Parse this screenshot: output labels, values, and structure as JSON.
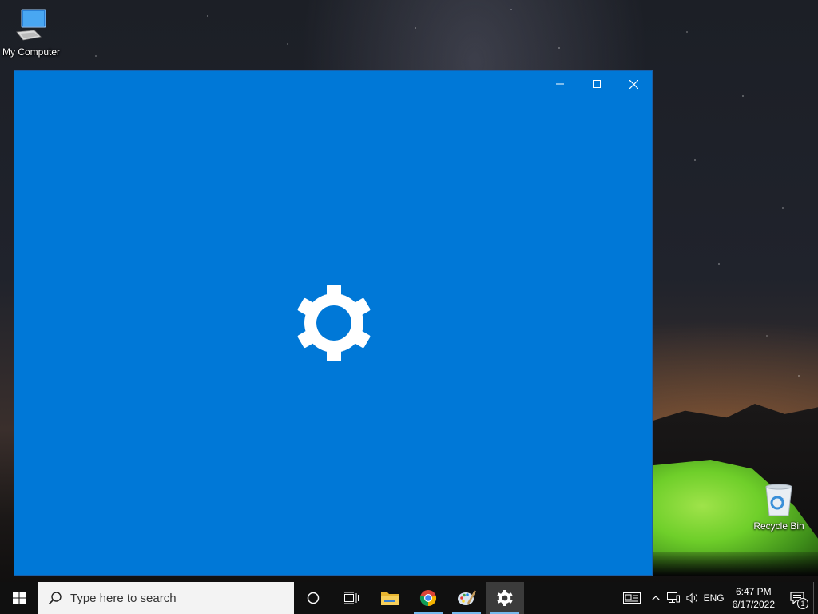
{
  "desktop": {
    "icons": [
      {
        "label": "My Computer",
        "icon": "computer-icon"
      },
      {
        "label": "Recycle Bin",
        "icon": "recycle-bin-icon"
      }
    ]
  },
  "window": {
    "background": "#0078d7",
    "center_icon": "gear-icon",
    "controls": [
      "minimize-icon",
      "maximize-icon",
      "close-icon"
    ]
  },
  "taskbar": {
    "search_placeholder": "Type here to search",
    "pinned": [
      {
        "name": "cortana",
        "icon": "cortana-circle-icon"
      },
      {
        "name": "task-view",
        "icon": "task-view-icon"
      },
      {
        "name": "file-explorer",
        "icon": "folder-icon"
      },
      {
        "name": "chrome",
        "icon": "chrome-icon",
        "running": true
      },
      {
        "name": "paint",
        "icon": "paint-icon",
        "running": true
      },
      {
        "name": "settings",
        "icon": "gear-icon",
        "running": true,
        "active": true
      }
    ],
    "tray": {
      "language": "ENG",
      "time": "6:47 PM",
      "date": "6/17/2022",
      "notification_count": "1"
    }
  }
}
